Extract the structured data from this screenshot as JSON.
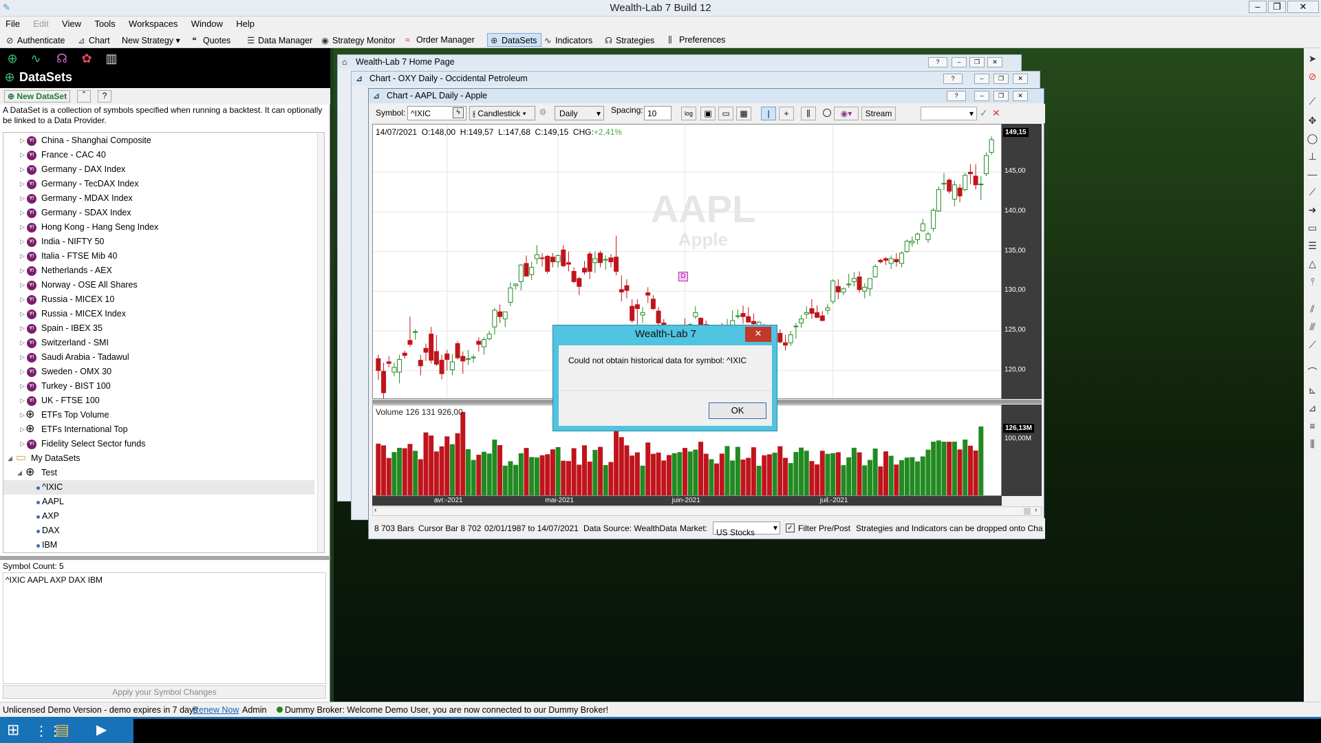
{
  "app": {
    "title": "Wealth-Lab 7 Build 12"
  },
  "menu": [
    "File",
    "Edit",
    "View",
    "Tools",
    "Workspaces",
    "Window",
    "Help"
  ],
  "toolbar": {
    "authenticate": "Authenticate",
    "chart": "Chart",
    "new_strategy": "New Strategy",
    "quotes": "Quotes",
    "data_manager": "Data Manager",
    "strategy_monitor": "Strategy Monitor",
    "order_manager": "Order Manager",
    "datasets": "DataSets",
    "indicators": "Indicators",
    "strategies": "Strategies",
    "preferences": "Preferences"
  },
  "left_panel": {
    "title": "DataSets",
    "new_dataset": "New DataSet",
    "description": "A DataSet is a collection of symbols specified when running a backtest. It can optionally be linked to a Data Provider.",
    "tree": [
      {
        "label": "China - Shanghai Composite",
        "type": "yahoo"
      },
      {
        "label": "France - CAC 40",
        "type": "yahoo"
      },
      {
        "label": "Germany - DAX Index",
        "type": "yahoo"
      },
      {
        "label": "Germany - TecDAX Index",
        "type": "yahoo"
      },
      {
        "label": "Germany - MDAX Index",
        "type": "yahoo"
      },
      {
        "label": "Germany - SDAX Index",
        "type": "yahoo"
      },
      {
        "label": "Hong Kong - Hang Seng Index",
        "type": "yahoo"
      },
      {
        "label": "India - NIFTY 50",
        "type": "yahoo"
      },
      {
        "label": "Italia - FTSE Mib 40",
        "type": "yahoo"
      },
      {
        "label": "Netherlands - AEX",
        "type": "yahoo"
      },
      {
        "label": "Norway - OSE All Shares",
        "type": "yahoo"
      },
      {
        "label": "Russia - MICEX 10",
        "type": "yahoo"
      },
      {
        "label": "Russia - MICEX Index",
        "type": "yahoo"
      },
      {
        "label": "Spain - IBEX 35",
        "type": "yahoo"
      },
      {
        "label": "Switzerland - SMI",
        "type": "yahoo"
      },
      {
        "label": "Saudi Arabia - Tadawul",
        "type": "yahoo"
      },
      {
        "label": "Sweden - OMX 30",
        "type": "yahoo"
      },
      {
        "label": "Turkey - BIST 100",
        "type": "yahoo"
      },
      {
        "label": "UK - FTSE 100",
        "type": "yahoo"
      },
      {
        "label": "ETFs Top Volume",
        "type": "globe"
      },
      {
        "label": "ETFs International Top",
        "type": "globe"
      },
      {
        "label": "Fidelity Select Sector funds",
        "type": "yahoo"
      }
    ],
    "my_datasets": "My DataSets",
    "test": "Test",
    "symbols": [
      "^IXIC",
      "AAPL",
      "AXP",
      "DAX",
      "IBM"
    ],
    "symbol_count": "Symbol Count: 5",
    "symbol_list": "^IXIC AAPL AXP DAX IBM",
    "apply_button": "Apply your Symbol Changes"
  },
  "windows": {
    "home": "Wealth-Lab 7 Home Page",
    "oxy": "Chart - OXY Daily - Occidental Petroleum",
    "aapl": "Chart - AAPL Daily - Apple"
  },
  "chart_toolbar": {
    "symbol_label": "Symbol:",
    "symbol": "^IXIC",
    "style": "Candlestick",
    "scale": "Daily",
    "spacing_label": "Spacing:",
    "spacing": "10",
    "log": "log",
    "stream": "Stream"
  },
  "chart_info": {
    "date": "14/07/2021",
    "o": "O:148,00",
    "h": "H:149,57",
    "l": "L:147,68",
    "c": "C:149,15",
    "chg_label": "CHG:",
    "chg": "+2,41%",
    "watermark_symbol": "AAPL",
    "watermark_name": "Apple",
    "last_price": "149,15",
    "volume_label": "Volume 126 131 926,00",
    "last_volume": "126,13M",
    "volume_tick": "100,00M"
  },
  "chart_data": {
    "type": "candlestick",
    "ylim": [
      116.5,
      151
    ],
    "y_ticks": [
      "145,00",
      "140,00",
      "135,00",
      "130,00",
      "125,00",
      "120,00"
    ],
    "x_ticks": [
      "avr.-2021",
      "mai-2021",
      "juin-2021",
      "juil.-2021"
    ],
    "ohlc": [
      [
        121.5,
        122,
        118.8,
        120
      ],
      [
        119.9,
        121,
        116.5,
        117.2
      ],
      [
        121.1,
        121.8,
        120.4,
        120.9
      ],
      [
        119.8,
        121,
        119.3,
        120.4
      ],
      [
        119.8,
        122,
        118.4,
        121.4
      ],
      [
        122.2,
        122.5,
        121.5,
        121.9
      ],
      [
        123.8,
        126.8,
        123,
        123.3
      ],
      [
        124.8,
        125.2,
        123.9,
        124.9
      ],
      [
        121.3,
        122,
        119.4,
        120.6
      ],
      [
        122.8,
        123.4,
        121.2,
        122.3
      ],
      [
        124.6,
        125.5,
        120.9,
        121.3
      ],
      [
        122.4,
        124.5,
        120.6,
        120.8
      ],
      [
        121.3,
        122,
        118.9,
        119.6
      ],
      [
        122.1,
        122.6,
        120,
        121.4
      ],
      [
        120.1,
        122.1,
        119.4,
        121.1
      ],
      [
        123.4,
        123.7,
        121.4,
        121.6
      ],
      [
        121.8,
        122.4,
        119.6,
        121.2
      ],
      [
        121.5,
        122.6,
        120.7,
        121.5
      ],
      [
        121.6,
        122,
        121,
        121.7
      ],
      [
        123.7,
        124.2,
        122.4,
        123.3
      ],
      [
        123,
        124.2,
        122,
        123.9
      ],
      [
        124,
        125,
        123.8,
        124.6
      ],
      [
        125.5,
        127.9,
        124.5,
        127.6
      ],
      [
        127.4,
        128.3,
        126,
        126.8
      ],
      [
        126.5,
        127.2,
        125.5,
        127.4
      ],
      [
        128.6,
        131.1,
        128.1,
        130.4
      ],
      [
        130.7,
        131,
        130.2,
        130.9
      ],
      [
        131.2,
        133.4,
        130.1,
        133.3
      ],
      [
        133.5,
        134.5,
        131.9,
        131.9
      ],
      [
        132.1,
        133.7,
        131.4,
        133
      ],
      [
        134.1,
        135.8,
        133.4,
        134.6
      ],
      [
        134.2,
        134.8,
        133.1,
        134.1
      ],
      [
        134.4,
        134.6,
        132.2,
        132.5
      ],
      [
        134.3,
        134.8,
        133,
        133.7
      ],
      [
        133.7,
        134.6,
        133,
        134.5
      ],
      [
        135.2,
        135.8,
        133,
        133.2
      ],
      [
        133.6,
        135,
        132.5,
        133.4
      ],
      [
        132.5,
        133,
        131,
        131.2
      ],
      [
        131.6,
        131.8,
        129.5,
        130.6
      ],
      [
        132.9,
        133.8,
        132.1,
        132.4
      ],
      [
        134.7,
        135,
        131.5,
        132.5
      ],
      [
        133.6,
        135,
        132.3,
        134.1
      ],
      [
        134.8,
        135.1,
        133,
        133.6
      ],
      [
        134,
        134.5,
        132.7,
        134
      ],
      [
        134.2,
        134.7,
        133,
        133.7
      ],
      [
        134.3,
        137,
        132,
        132.5
      ],
      [
        130.2,
        132,
        128.7,
        129.9
      ],
      [
        130.7,
        131.5,
        129.1,
        130.1
      ],
      [
        128.1,
        129,
        126,
        126.3
      ],
      [
        128.3,
        129,
        125.8,
        127.8
      ],
      [
        127,
        128,
        126,
        127.3
      ],
      [
        129.8,
        130.5,
        128.5,
        129.5
      ],
      [
        129,
        129.5,
        127.6,
        127.8
      ],
      [
        127.5,
        128,
        125.5,
        126
      ],
      [
        126,
        126.5,
        124.3,
        124.5
      ],
      [
        124.5,
        125.5,
        123.8,
        124.3
      ],
      [
        124,
        125.5,
        123.3,
        125.2
      ],
      [
        124.5,
        125.2,
        123.5,
        124.6
      ],
      [
        125.5,
        126.6,
        124.7,
        125.3
      ],
      [
        125.1,
        126,
        124.2,
        125.8
      ],
      [
        126.8,
        128.1,
        126.5,
        127.3
      ],
      [
        126.6,
        126.7,
        124.5,
        125.1
      ],
      [
        125.8,
        126.3,
        124.3,
        124.3
      ],
      [
        124.5,
        125.5,
        123.8,
        124.5
      ],
      [
        124.7,
        125.5,
        123.5,
        124.5
      ],
      [
        125.1,
        126,
        124.3,
        124.2
      ],
      [
        124.8,
        126.5,
        124.1,
        124.9
      ],
      [
        125.4,
        127.6,
        124.3,
        126.3
      ],
      [
        126.9,
        127.7,
        126.5,
        126.9
      ],
      [
        127.2,
        128.2,
        125.9,
        126.8
      ],
      [
        126.8,
        128,
        126.1,
        126.1
      ],
      [
        126.2,
        127.2,
        124.8,
        125.9
      ],
      [
        125.5,
        126.2,
        124.8,
        126.1
      ],
      [
        125.1,
        125.9,
        124.6,
        125
      ],
      [
        124.7,
        125.3,
        124.1,
        124.3
      ],
      [
        124,
        124.8,
        123.5,
        124
      ],
      [
        124.7,
        125.2,
        123.4,
        123.6
      ],
      [
        123.5,
        124.5,
        122.5,
        123.2
      ],
      [
        123.5,
        125,
        123.1,
        124.5
      ],
      [
        125.6,
        126,
        124,
        125.6
      ],
      [
        126,
        127,
        125.4,
        126.5
      ],
      [
        127.1,
        128.1,
        126.5,
        127.3
      ],
      [
        127.8,
        129,
        126.5,
        127.2
      ],
      [
        127.3,
        128.2,
        126.6,
        126.7
      ],
      [
        126.9,
        127.5,
        126.2,
        126.3
      ],
      [
        127.6,
        128.4,
        127.1,
        127.9
      ],
      [
        128.7,
        131.5,
        128.4,
        131.3
      ],
      [
        130.6,
        131.5,
        129,
        129.9
      ],
      [
        129.9,
        130.5,
        129.5,
        130.3
      ],
      [
        130.8,
        132.2,
        130.4,
        130.9
      ],
      [
        131.2,
        132.4,
        130.6,
        131.6
      ],
      [
        131.8,
        132.5,
        129.8,
        130.2
      ],
      [
        130,
        131,
        129.1,
        130.5
      ],
      [
        130.3,
        131.5,
        129.4,
        131.6
      ],
      [
        131.8,
        133.4,
        131.7,
        133.1
      ],
      [
        133.9,
        134.1,
        133.5,
        133.7
      ],
      [
        134.1,
        134.3,
        133.3,
        133.9
      ],
      [
        133.5,
        134.5,
        132.8,
        134.1
      ],
      [
        134,
        134.8,
        133.1,
        133.7
      ],
      [
        133.5,
        135,
        133,
        134.8
      ],
      [
        135,
        136.5,
        134.8,
        136.3
      ],
      [
        136.1,
        136.9,
        135.6,
        136.3
      ],
      [
        136.5,
        137.4,
        135.9,
        137.2
      ],
      [
        137.6,
        139.1,
        137.5,
        138.5
      ],
      [
        136.5,
        137.5,
        136.1,
        137.2
      ],
      [
        137.9,
        140.5,
        137.5,
        140.2
      ],
      [
        140.1,
        143.2,
        140,
        142.8
      ],
      [
        143.5,
        144.9,
        142.7,
        143.6
      ],
      [
        144,
        144.2,
        142.3,
        142.6
      ],
      [
        141.6,
        143.9,
        140.7,
        143.4
      ],
      [
        143,
        143.5,
        141.2,
        142
      ],
      [
        142.8,
        144.9,
        142.6,
        144.6
      ],
      [
        145,
        146,
        143.5,
        144.8
      ],
      [
        144.5,
        146,
        142.8,
        143.4
      ],
      [
        143.5,
        144.5,
        141.5,
        143.5
      ],
      [
        144.8,
        147.5,
        144.5,
        147.1
      ],
      [
        147.5,
        149.5,
        147.2,
        149.1
      ]
    ],
    "volume": [
      94.6,
      91.4,
      68.4,
      79.2,
      87.0,
      86.2,
      94.1,
      81.5,
      66.1,
      115.2,
      109.5,
      80.3,
      89.7,
      108.0,
      93.6,
      113.7,
      152.5,
      84.5,
      64.9,
      74.3,
      79.8,
      76.5,
      102.1,
      92.0,
      54.3,
      62.5,
      55.9,
      77.1,
      86.8,
      70.1,
      69.5,
      73.4,
      75.3,
      84.2,
      88.3,
      63.4,
      62.7,
      86.3,
      56.1,
      91.6,
      61.7,
      83.2,
      88.7,
      55.4,
      61.0,
      149.2,
      106.6,
      91.5,
      72.8,
      78.7,
      54.3,
      96.8,
      76.0,
      78.3,
      63.8,
      73.8,
      77.1,
      79.1,
      86.8,
      80.3,
      83.8,
      98.1,
      76.2,
      66.1,
      58.4,
      76.4,
      90.2,
      63.8,
      88.7,
      65.5,
      68.7,
      88.0,
      54.1,
      73.4,
      75.1,
      78.1,
      89.9,
      68.6,
      59.1,
      79.3,
      87.4,
      81.7,
      62.7,
      56.6,
      81.6,
      76.0,
      77.3,
      78.9,
      55.2,
      69.6,
      87.1,
      78.7,
      54.9,
      64.8,
      85.7,
      52.9,
      80.5,
      72.4,
      56.4,
      64.4,
      69.1,
      69.9,
      62.1,
      71.2,
      83.5,
      98.3,
      100.5,
      98.2,
      98.1,
      98.3,
      84.0,
      102.1,
      90.9,
      82.1,
      126.1
    ]
  },
  "status": {
    "bars": "8 703 Bars",
    "cursor": "Cursor Bar 8 702",
    "range": "02/01/1987 to 14/07/2021",
    "datasource": "Data Source: WealthData",
    "market_label": "Market:",
    "market": "US Stocks",
    "filter": "Filter Pre/Post",
    "drop_hint": "Strategies and Indicators can be dropped onto Cha"
  },
  "dialog": {
    "title": "Wealth-Lab 7",
    "message": "Could not obtain historical data for symbol: ^IXIC",
    "ok": "OK"
  },
  "app_status": {
    "license": "Unlicensed Demo Version - demo expires in 7 days",
    "renew": "Renew Now",
    "user": "Admin",
    "broker": "Dummy Broker: Welcome Demo User, you are now connected to our Dummy Broker!"
  },
  "colors": {
    "up": "#218a21",
    "down": "#c0141c",
    "accent": "#4fc3df",
    "chg": "#3fae3f"
  }
}
